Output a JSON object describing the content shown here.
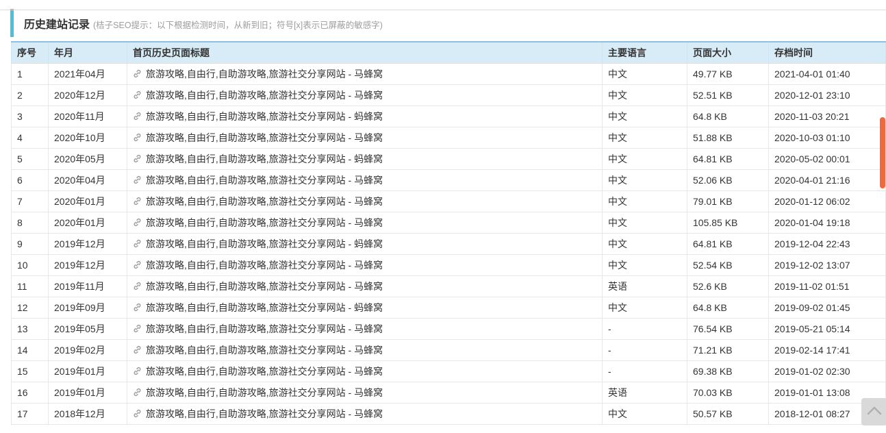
{
  "colors": {
    "accent_cyan": "#46c1de",
    "table_header_bg": "#d8ecf7",
    "table_header_top_border": "#8cc0de",
    "scrollbar_thumb_orange": "#f0683e",
    "back_to_top_bg": "#d9d9d9"
  },
  "header": {
    "title": "历史建站记录",
    "hint": "(桔子SEO提示：以下根据检测时间，从新到旧；符号[x]表示已屏蔽的敏感字)"
  },
  "table": {
    "headers": [
      "序号",
      "年月",
      "首页历史页面标题",
      "主要语言",
      "页面大小",
      "存档时间"
    ],
    "rows": [
      {
        "num": "1",
        "month": "2021年04月",
        "title": "旅游攻略,自由行,自助游攻略,旅游社交分享网站 - 马蜂窝",
        "lang": "中文",
        "size": "49.77 KB",
        "time": "2021-04-01 01:40"
      },
      {
        "num": "2",
        "month": "2020年12月",
        "title": "旅游攻略,自由行,自助游攻略,旅游社交分享网站 - 马蜂窝",
        "lang": "中文",
        "size": "52.51 KB",
        "time": "2020-12-01 23:10"
      },
      {
        "num": "3",
        "month": "2020年11月",
        "title": "旅游攻略,自由行,自助游攻略,旅游社交分享网站 - 蚂蜂窝",
        "lang": "中文",
        "size": "64.8 KB",
        "time": "2020-11-03 20:21"
      },
      {
        "num": "4",
        "month": "2020年10月",
        "title": "旅游攻略,自由行,自助游攻略,旅游社交分享网站 - 马蜂窝",
        "lang": "中文",
        "size": "51.88 KB",
        "time": "2020-10-03 01:10"
      },
      {
        "num": "5",
        "month": "2020年05月",
        "title": "旅游攻略,自由行,自助游攻略,旅游社交分享网站 - 蚂蜂窝",
        "lang": "中文",
        "size": "64.81 KB",
        "time": "2020-05-02 00:01"
      },
      {
        "num": "6",
        "month": "2020年04月",
        "title": "旅游攻略,自由行,自助游攻略,旅游社交分享网站 - 马蜂窝",
        "lang": "中文",
        "size": "52.06 KB",
        "time": "2020-04-01 21:16"
      },
      {
        "num": "7",
        "month": "2020年01月",
        "title": "旅游攻略,自由行,自助游攻略,旅游社交分享网站 - 马蜂窝",
        "lang": "中文",
        "size": "79.01 KB",
        "time": "2020-01-12 06:02"
      },
      {
        "num": "8",
        "month": "2020年01月",
        "title": "旅游攻略,自由行,自助游攻略,旅游社交分享网站 - 马蜂窝",
        "lang": "中文",
        "size": "105.85 KB",
        "time": "2020-01-04 19:18"
      },
      {
        "num": "9",
        "month": "2019年12月",
        "title": "旅游攻略,自由行,自助游攻略,旅游社交分享网站 - 蚂蜂窝",
        "lang": "中文",
        "size": "64.81 KB",
        "time": "2019-12-04 22:43"
      },
      {
        "num": "10",
        "month": "2019年12月",
        "title": "旅游攻略,自由行,自助游攻略,旅游社交分享网站 - 马蜂窝",
        "lang": "中文",
        "size": "52.54 KB",
        "time": "2019-12-02 13:07"
      },
      {
        "num": "11",
        "month": "2019年11月",
        "title": "旅游攻略,自由行,自助游攻略,旅游社交分享网站 - 马蜂窝",
        "lang": "英语",
        "size": "52.6 KB",
        "time": "2019-11-02 01:51"
      },
      {
        "num": "12",
        "month": "2019年09月",
        "title": "旅游攻略,自由行,自助游攻略,旅游社交分享网站 - 蚂蜂窝",
        "lang": "中文",
        "size": "64.8 KB",
        "time": "2019-09-02 01:45"
      },
      {
        "num": "13",
        "month": "2019年05月",
        "title": "旅游攻略,自由行,自助游攻略,旅游社交分享网站 - 马蜂窝",
        "lang": "-",
        "size": "76.54 KB",
        "time": "2019-05-21 05:14"
      },
      {
        "num": "14",
        "month": "2019年02月",
        "title": "旅游攻略,自由行,自助游攻略,旅游社交分享网站 - 马蜂窝",
        "lang": "-",
        "size": "71.21 KB",
        "time": "2019-02-14 17:41"
      },
      {
        "num": "15",
        "month": "2019年01月",
        "title": "旅游攻略,自由行,自助游攻略,旅游社交分享网站 - 马蜂窝",
        "lang": "-",
        "size": "69.38 KB",
        "time": "2019-01-02 02:30"
      },
      {
        "num": "16",
        "month": "2019年01月",
        "title": "旅游攻略,自由行,自助游攻略,旅游社交分享网站 - 马蜂窝",
        "lang": "英语",
        "size": "70.03 KB",
        "time": "2019-01-01 13:08"
      },
      {
        "num": "17",
        "month": "2018年12月",
        "title": "旅游攻略,自由行,自助游攻略,旅游社交分享网站 - 马蜂窝",
        "lang": "中文",
        "size": "50.57 KB",
        "time": "2018-12-01 08:27"
      }
    ]
  },
  "icons": {
    "row_link": "link-icon",
    "back_to_top": "chevron-up-icon"
  }
}
